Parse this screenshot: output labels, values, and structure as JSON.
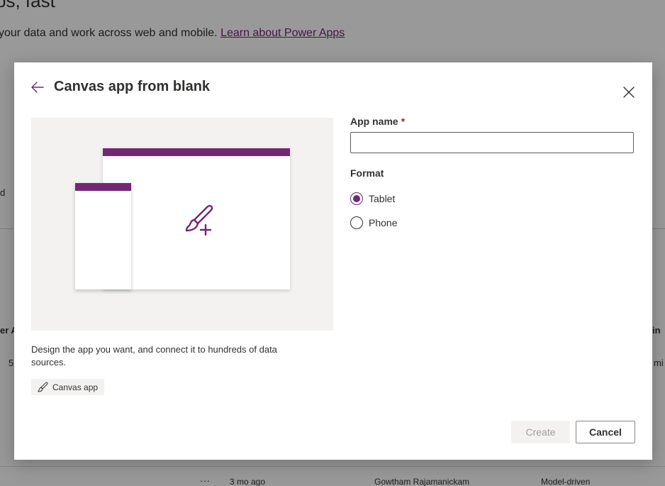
{
  "background": {
    "title": "ps, fast",
    "subtitle": "your data and work across web and mobile.",
    "learn_link": "Learn about Power Apps",
    "frag_d": "d",
    "frag_left_col": "er A",
    "frag_left_val": "5",
    "frag_right_col": "in",
    "frag_right_val": "mi",
    "row": {
      "more": "···",
      "modified": "3 mo ago",
      "owner": "Gowtham Rajamanickam",
      "type": "Model-driven"
    }
  },
  "dialog": {
    "title": "Canvas app from blank",
    "description": "Design the app you want, and connect it to hundreds of data sources.",
    "tag_label": "Canvas app",
    "app_name_label": "App name",
    "required_mark": "*",
    "app_name_value": "",
    "format_label": "Format",
    "format_options": [
      {
        "label": "Tablet",
        "checked": true
      },
      {
        "label": "Phone",
        "checked": false
      }
    ],
    "create_label": "Create",
    "cancel_label": "Cancel"
  },
  "colors": {
    "accent": "#742774",
    "required": "#a4262c",
    "overlay": "rgba(0,0,0,0.40)"
  },
  "icons": {
    "back": "arrow-left-icon",
    "close": "close-icon",
    "brush": "paintbrush-plus-icon",
    "tag": "paintbrush-icon"
  }
}
